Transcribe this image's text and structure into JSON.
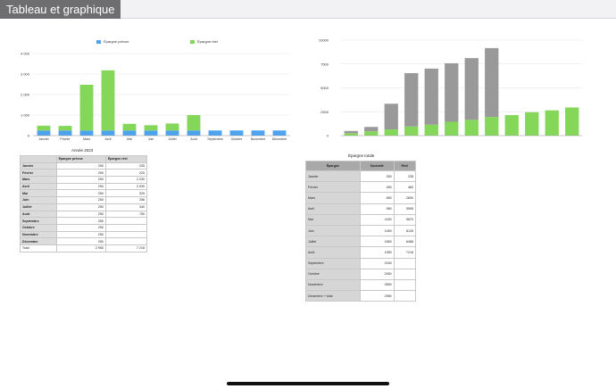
{
  "sheet_tab": "Tableau et graphique",
  "colors": {
    "prevu": "#4da3ee",
    "reel": "#85d75a",
    "gray": "#999999"
  },
  "table1": {
    "caption": "Année 2023",
    "headers": [
      "",
      "Épargne prévue",
      "Épargne réel"
    ],
    "rows": [
      [
        "Janvier",
        "250",
        "235"
      ],
      [
        "Février",
        "250",
        "225"
      ],
      [
        "Mars",
        "250",
        "2 230"
      ],
      [
        "Avril",
        "250",
        "2 930"
      ],
      [
        "Mai",
        "250",
        "325"
      ],
      [
        "Juin",
        "250",
        "256"
      ],
      [
        "Juillet",
        "250",
        "340"
      ],
      [
        "Août",
        "250",
        "750"
      ],
      [
        "Septembre",
        "250",
        ""
      ],
      [
        "Octobre",
        "250",
        ""
      ],
      [
        "Novembre",
        "250",
        ""
      ],
      [
        "Décembre",
        "250",
        ""
      ],
      [
        "Total",
        "2 950",
        "7 218"
      ]
    ]
  },
  "table2": {
    "caption": "Épargne totale",
    "headers": [
      "Épargne",
      "Souhaité",
      "Réel"
    ],
    "rows": [
      [
        "Janvier",
        "250",
        "235"
      ],
      [
        "Février",
        "450",
        "460"
      ],
      [
        "Mars",
        "650",
        "2690"
      ],
      [
        "Avril",
        "950",
        "5595"
      ],
      [
        "Mai",
        "1150",
        "5870"
      ],
      [
        "Juin",
        "1450",
        "6126"
      ],
      [
        "Juillet",
        "1650",
        "6468"
      ],
      [
        "Août",
        "1950",
        "7218"
      ],
      [
        "Septembre",
        "2150",
        ""
      ],
      [
        "Octobre",
        "2450",
        ""
      ],
      [
        "Novembre",
        "2650",
        ""
      ],
      [
        "Décembre + total",
        "2950",
        ""
      ]
    ]
  },
  "chart_data": [
    {
      "type": "bar",
      "stacked": true,
      "categories": [
        "Janvier",
        "Février",
        "Mars",
        "Avril",
        "Mai",
        "Juin",
        "Juillet",
        "Août",
        "Septembre",
        "Octobre",
        "Novembre",
        "Décembre"
      ],
      "series": [
        {
          "name": "Épargne prévue",
          "values": [
            250,
            250,
            250,
            250,
            250,
            250,
            250,
            250,
            250,
            250,
            250,
            250
          ]
        },
        {
          "name": "Épargne réel",
          "values": [
            235,
            225,
            2230,
            2930,
            325,
            256,
            340,
            750,
            0,
            0,
            0,
            0
          ]
        }
      ],
      "yticks": [
        "0",
        "1 000",
        "2 000",
        "3 000",
        "4 000"
      ],
      "ylim": [
        0,
        4000
      ],
      "legend": "top-center",
      "grid": true
    },
    {
      "type": "bar",
      "stacked": true,
      "series": [
        {
          "values": [
            250,
            450,
            650,
            950,
            1150,
            1450,
            1650,
            1950,
            2150,
            2450,
            2650,
            2950
          ]
        },
        {
          "values": [
            235,
            460,
            2690,
            5595,
            5870,
            6126,
            6468,
            7218,
            0,
            0,
            0,
            0
          ]
        }
      ],
      "yticks": [
        "0",
        "2500",
        "5000",
        "7500",
        "10000"
      ],
      "ylim": [
        0,
        10000
      ],
      "grid": true
    }
  ]
}
